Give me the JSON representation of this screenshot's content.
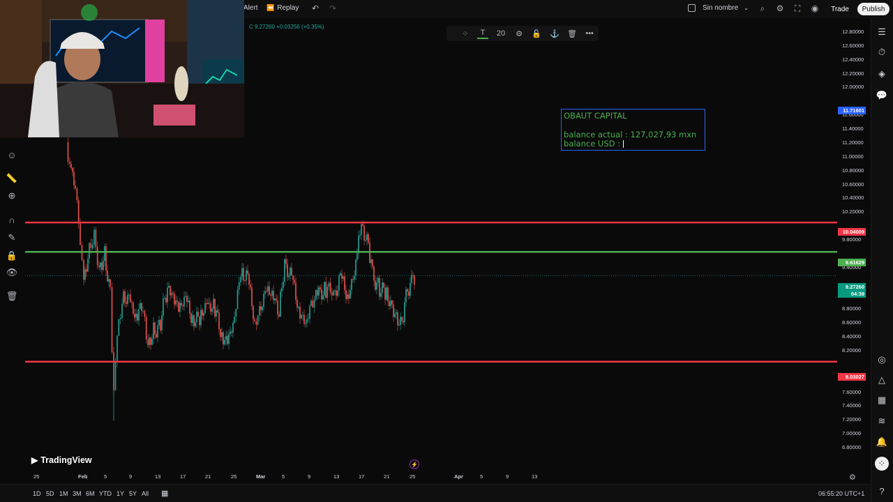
{
  "topbar": {
    "alert_label": "Alert",
    "replay_label": "Replay",
    "layout_name": "Sin nombre",
    "trade_label": "Trade",
    "publish_label": "Publish"
  },
  "symbol": {
    "price_change": "C 9.27260 +0.03256 (+0.35%)"
  },
  "drawing_toolbar": {
    "font_size": "20"
  },
  "note": {
    "line1": "OBAUT CAPITAL",
    "line2": "",
    "line3": "balance actual : 127,027,93 mxn",
    "line4": "balance USD : "
  },
  "price_axis": {
    "ticks": [
      "12.80000",
      "12.60000",
      "12.40000",
      "12.20000",
      "12.00000",
      "11.60000",
      "11.40000",
      "11.20000",
      "11.00000",
      "10.80000",
      "10.60000",
      "10.40000",
      "10.20000",
      "9.80000",
      "9.40000",
      "9.00000",
      "8.80000",
      "8.60000",
      "8.40000",
      "8.20000",
      "7.80000",
      "7.60000",
      "7.40000",
      "7.20000",
      "7.00000",
      "6.80000"
    ],
    "badges": [
      {
        "text": "11.71601",
        "color": "#2962ff"
      },
      {
        "text": "10.04009",
        "color": "#f23645"
      },
      {
        "text": "9.61629",
        "color": "#4caf50"
      },
      {
        "text": "9.27260",
        "color": "#089981"
      },
      {
        "text": "04:39",
        "color": "#089981"
      },
      {
        "text": "8.03027",
        "color": "#f23645"
      }
    ]
  },
  "time_axis": {
    "ticks": [
      "25",
      "Feb",
      "5",
      "9",
      "13",
      "17",
      "21",
      "25",
      "Mar",
      "5",
      "9",
      "13",
      "17",
      "21",
      "25",
      "Apr",
      "5",
      "9",
      "13"
    ]
  },
  "horizontal_lines": [
    {
      "price": 10.04009,
      "color": "#f23645"
    },
    {
      "price": 9.61629,
      "color": "#4caf50"
    },
    {
      "price": 8.03027,
      "color": "#f23645"
    }
  ],
  "bottombar": {
    "ranges": [
      "1D",
      "5D",
      "1M",
      "3M",
      "6M",
      "YTD",
      "1Y",
      "5Y",
      "All"
    ],
    "clock": "06:55:20 UTC+1"
  },
  "brand": {
    "logo_text": "TradingView"
  },
  "colors": {
    "up": "#26a69a",
    "down": "#ef5350",
    "accent": "#2962ff"
  }
}
